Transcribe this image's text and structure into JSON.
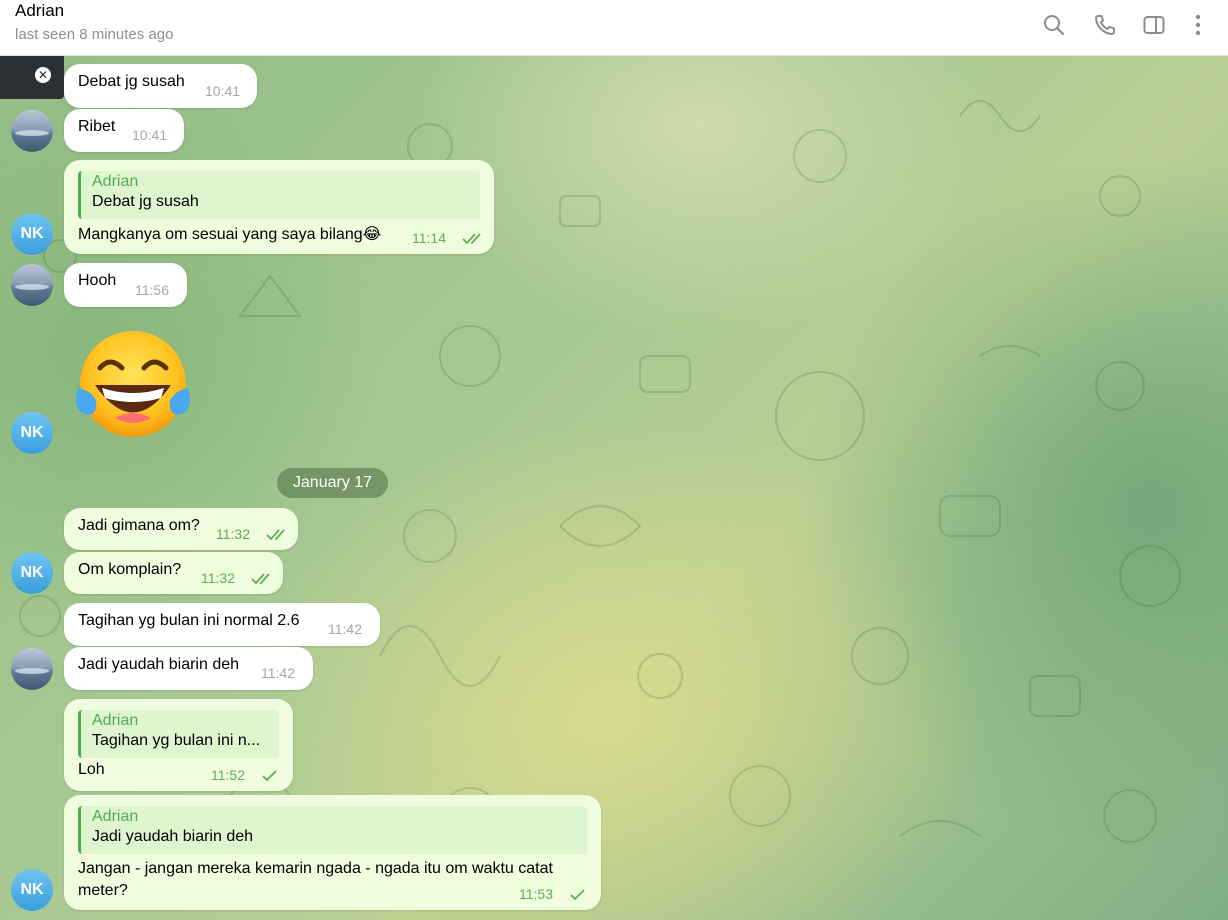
{
  "header": {
    "name": "Adrian",
    "status": "last seen 8 minutes ago",
    "icons": [
      "search-icon",
      "phone-icon",
      "sidebar-toggle-icon",
      "more-vertical-icon"
    ]
  },
  "close_tab": {
    "icon": "close-icon"
  },
  "avatars": {
    "nk_initials": "NK"
  },
  "date_separator": "January 17",
  "messages": [
    {
      "id": "m1",
      "text": "Debat jg susah",
      "time": "10:41",
      "outgoing": false
    },
    {
      "id": "m2",
      "text": "Ribet",
      "time": "10:41",
      "outgoing": false
    },
    {
      "id": "m3",
      "reply_name": "Adrian",
      "reply_text": "Debat jg susah",
      "text": "Mangkanya om sesuai yang saya bilang😂",
      "time": "11:14",
      "outgoing": true,
      "status": "read"
    },
    {
      "id": "m4",
      "text": "Hooh",
      "time": "11:56",
      "outgoing": false
    },
    {
      "id": "m5",
      "sticker": "face-with-tears-of-joy",
      "outgoing": true
    },
    {
      "id": "m6",
      "text": "Jadi gimana om?",
      "time": "11:32",
      "outgoing": true,
      "status": "read"
    },
    {
      "id": "m7",
      "text": "Om komplain?",
      "time": "11:32",
      "outgoing": true,
      "status": "read"
    },
    {
      "id": "m8",
      "text": "Tagihan yg bulan ini normal 2.6",
      "time": "11:42",
      "outgoing": false
    },
    {
      "id": "m9",
      "text": "Jadi yaudah biarin deh",
      "time": "11:42",
      "outgoing": false
    },
    {
      "id": "m10",
      "reply_name": "Adrian",
      "reply_text": "Tagihan yg bulan ini n...",
      "text": "Loh",
      "time": "11:52",
      "outgoing": true,
      "status": "sent"
    },
    {
      "id": "m11",
      "reply_name": "Adrian",
      "reply_text": "Jadi yaudah biarin deh",
      "text": "Jangan - jangan mereka kemarin ngada - ngada itu om waktu catat\nmeter?",
      "time": "11:53",
      "outgoing": true,
      "status": "sent"
    }
  ],
  "colors": {
    "outgoing_bubble": "#effdde",
    "incoming_bubble": "#ffffff",
    "accent_green": "#4fae4e",
    "avatar_blue": "#3a9fdb"
  }
}
